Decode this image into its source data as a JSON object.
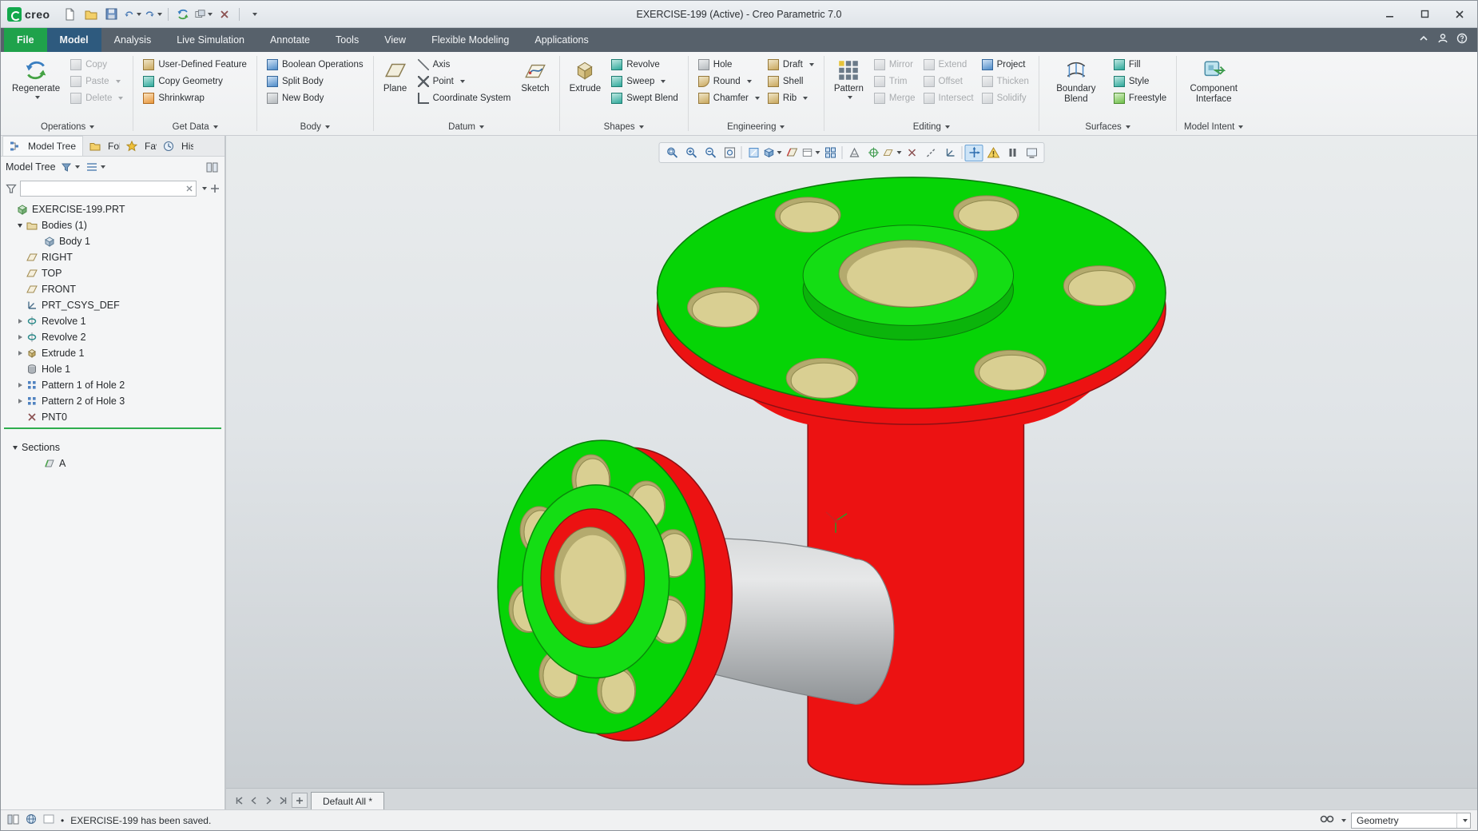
{
  "window": {
    "logo": "creo",
    "title": "EXERCISE-199 (Active) - Creo Parametric 7.0"
  },
  "tabs": {
    "items": [
      "File",
      "Model",
      "Analysis",
      "Live Simulation",
      "Annotate",
      "Tools",
      "View",
      "Flexible Modeling",
      "Applications"
    ],
    "active": "Model"
  },
  "ribbon": {
    "operations": {
      "footer": "Operations",
      "regenerate": "Regenerate",
      "copy": "Copy",
      "paste": "Paste",
      "delete": "Delete"
    },
    "get_data": {
      "footer": "Get Data",
      "udf": "User-Defined Feature",
      "copy_geometry": "Copy Geometry",
      "shrinkwrap": "Shrinkwrap"
    },
    "body": {
      "footer": "Body",
      "boolean": "Boolean Operations",
      "split": "Split Body",
      "new_body": "New Body"
    },
    "datum": {
      "footer": "Datum",
      "plane": "Plane",
      "axis": "Axis",
      "point": "Point",
      "csys": "Coordinate System",
      "sketch": "Sketch"
    },
    "shapes": {
      "footer": "Shapes",
      "extrude": "Extrude",
      "revolve": "Revolve",
      "sweep": "Sweep",
      "swept_blend": "Swept Blend"
    },
    "engineering": {
      "footer": "Engineering",
      "hole": "Hole",
      "draft": "Draft",
      "round": "Round",
      "shell": "Shell",
      "chamfer": "Chamfer",
      "rib": "Rib"
    },
    "editing": {
      "footer": "Editing",
      "pattern": "Pattern",
      "mirror": "Mirror",
      "trim": "Trim",
      "merge": "Merge",
      "extend": "Extend",
      "offset": "Offset",
      "intersect": "Intersect",
      "project": "Project",
      "thicken": "Thicken",
      "solidify": "Solidify"
    },
    "surfaces": {
      "footer": "Surfaces",
      "boundary_blend": "Boundary Blend",
      "fill": "Fill",
      "style": "Style",
      "freestyle": "Freestyle"
    },
    "model_intent": {
      "footer": "Model Intent",
      "component_interface": "Component Interface"
    }
  },
  "tree": {
    "tab_model_tree": "Model Tree",
    "tab_folder": "Fol",
    "tab_favorites": "Fav",
    "tab_history": "His",
    "header": "Model Tree",
    "items": [
      {
        "label": "EXERCISE-199.PRT"
      },
      {
        "label": "Bodies (1)"
      },
      {
        "label": "Body 1"
      },
      {
        "label": "RIGHT"
      },
      {
        "label": "TOP"
      },
      {
        "label": "FRONT"
      },
      {
        "label": "PRT_CSYS_DEF"
      },
      {
        "label": "Revolve 1"
      },
      {
        "label": "Revolve 2"
      },
      {
        "label": "Extrude 1"
      },
      {
        "label": "Hole 1"
      },
      {
        "label": "Pattern 1 of Hole 2"
      },
      {
        "label": "Pattern 2 of Hole 3"
      },
      {
        "label": "PNT0"
      }
    ],
    "sections_label": "Sections",
    "section_a": "A"
  },
  "viewport": {
    "tab": "Default All *"
  },
  "statusbar": {
    "bullet": "•",
    "message": "EXERCISE-199 has been saved.",
    "filter_value": "Geometry"
  },
  "icons": {
    "quick_access": [
      "new-file",
      "open",
      "save",
      "undo",
      "redo",
      "regenerate",
      "windows",
      "close-window",
      "customize"
    ],
    "graphics_toolbar": [
      "zoom-region",
      "zoom-in",
      "zoom-out",
      "refit",
      "repaint",
      "display-style",
      "section-view",
      "saved-orientations",
      "view-manager",
      "annotation-display",
      "spin-center",
      "orient-mode",
      "datum-display",
      "point-display",
      "axis-display",
      "csys-display",
      "dragger",
      "warning",
      "pause",
      "screen"
    ],
    "colors": {
      "accent_green": "#1fa24b",
      "active_tab": "#2e5a7e",
      "model_red": "#ec1212",
      "model_green": "#06d406",
      "model_tan": "#d9cf92",
      "insert_line": "#2fae4e"
    }
  }
}
